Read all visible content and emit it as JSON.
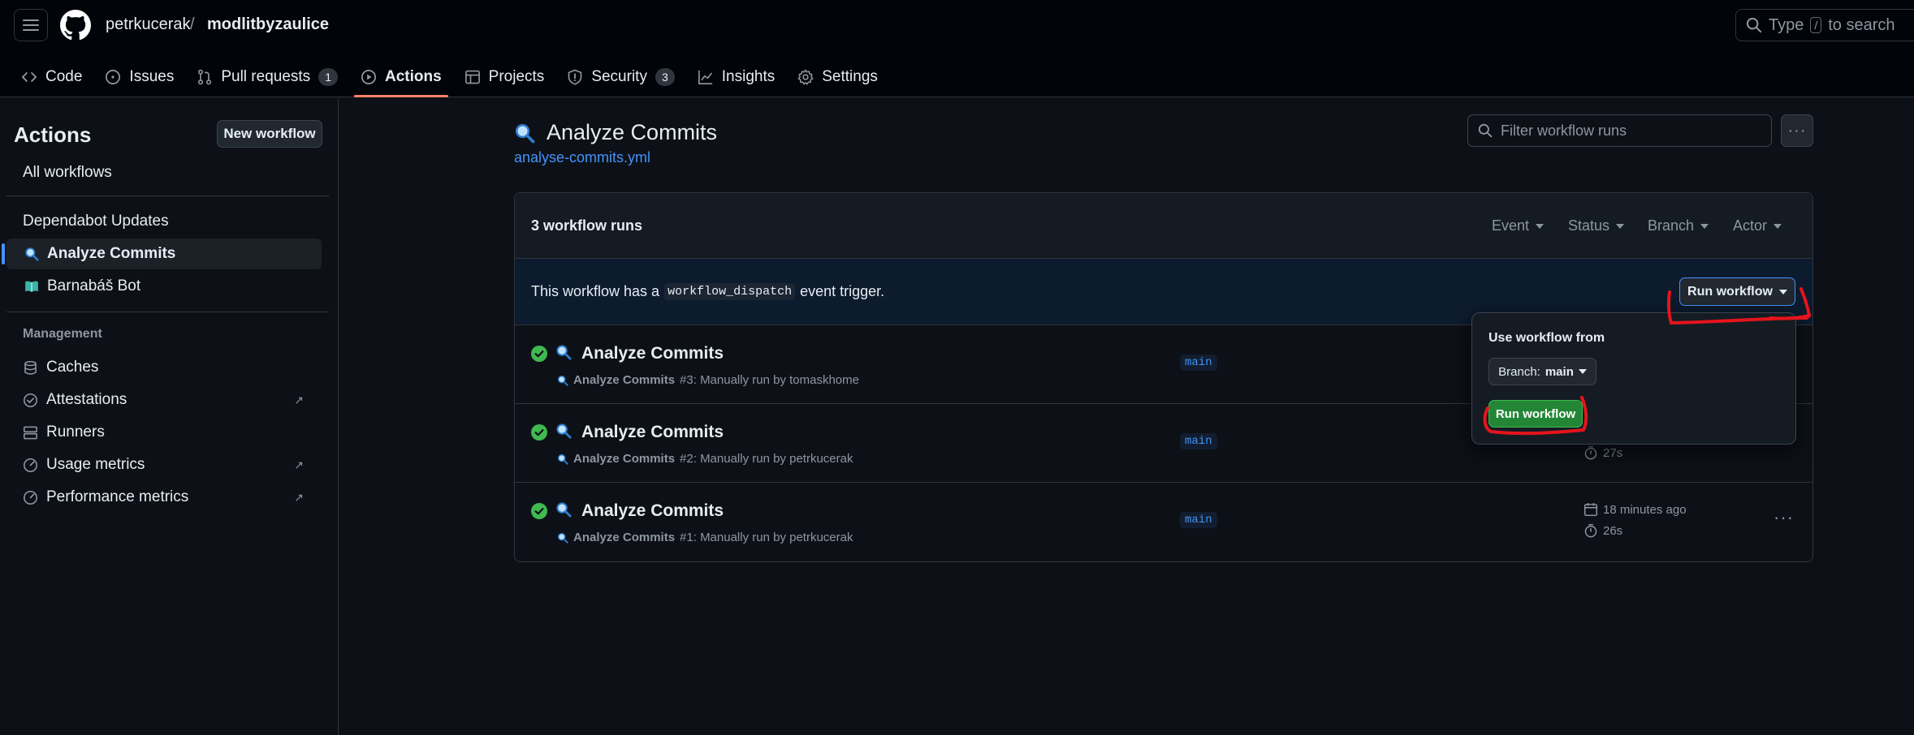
{
  "header": {
    "owner": "petrkucerak",
    "separator": "/",
    "repo": "modlitbyzaulice",
    "search_pre": "Type",
    "search_key": "/",
    "search_post": "to search"
  },
  "nav": {
    "code": "Code",
    "issues": "Issues",
    "pulls": "Pull requests",
    "pulls_count": "1",
    "actions": "Actions",
    "projects": "Projects",
    "security": "Security",
    "security_count": "3",
    "insights": "Insights",
    "settings": "Settings"
  },
  "sidebar": {
    "title": "Actions",
    "new_workflow": "New workflow",
    "all_workflows": "All workflows",
    "workflows": [
      {
        "label": "Dependabot Updates",
        "icon": ""
      },
      {
        "label": "Analyze Commits",
        "icon": "magnifier-icon"
      },
      {
        "label": "Barnabáš Bot",
        "icon": "book-icon"
      }
    ],
    "management_heading": "Management",
    "management": [
      {
        "label": "Caches",
        "icon": "database-icon",
        "external": false
      },
      {
        "label": "Attestations",
        "icon": "verified-icon",
        "external": true
      },
      {
        "label": "Runners",
        "icon": "server-icon",
        "external": false
      },
      {
        "label": "Usage metrics",
        "icon": "meter-icon",
        "external": true
      },
      {
        "label": "Performance metrics",
        "icon": "meter-icon",
        "external": true
      }
    ]
  },
  "main": {
    "title": "Analyze Commits",
    "file": "analyse-commits.yml",
    "filter_placeholder": "Filter workflow runs",
    "runs_count": "3 workflow runs",
    "filters": [
      "Event",
      "Status",
      "Branch",
      "Actor"
    ],
    "dispatch_pre": "This workflow has a",
    "dispatch_code": "workflow_dispatch",
    "dispatch_post": "event trigger.",
    "run_workflow": "Run workflow",
    "runs": [
      {
        "title": "Analyze Commits",
        "wf": "Analyze Commits",
        "detail": "#3: Manually run by tomaskhome",
        "branch": "main",
        "date": "",
        "duration": ""
      },
      {
        "title": "Analyze Commits",
        "wf": "Analyze Commits",
        "detail": "#2: Manually run by petrkucerak",
        "branch": "main",
        "date": "",
        "duration": "27s"
      },
      {
        "title": "Analyze Commits",
        "wf": "Analyze Commits",
        "detail": "#1: Manually run by petrkucerak",
        "branch": "main",
        "date": "18 minutes ago",
        "duration": "26s"
      }
    ]
  },
  "popover": {
    "label": "Use workflow from",
    "branch_prefix": "Branch:",
    "branch": "main",
    "run_button": "Run workflow"
  },
  "colors": {
    "accent": "#4493f8",
    "success": "#3fb950",
    "annotation": "#e5141b"
  }
}
